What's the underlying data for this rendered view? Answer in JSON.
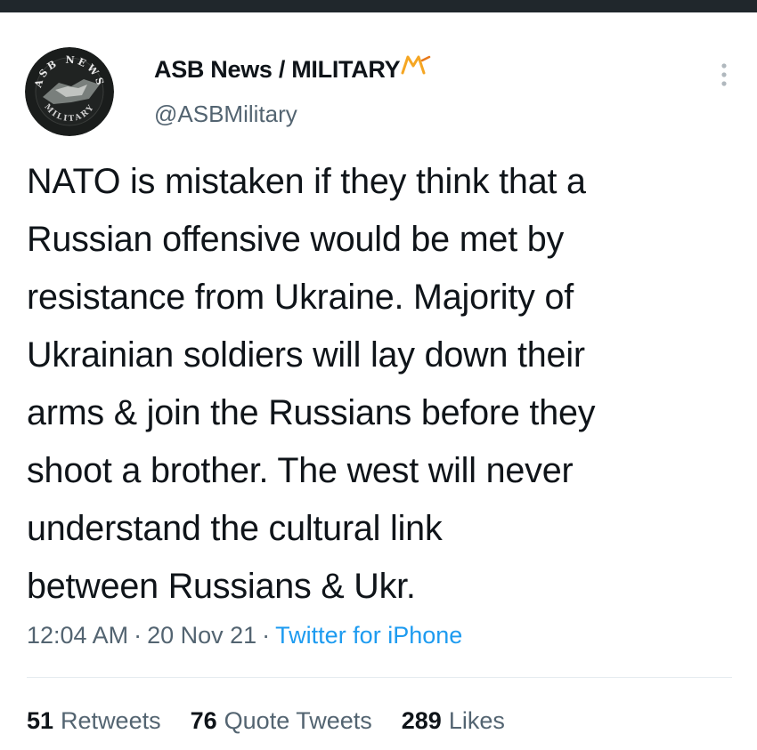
{
  "tweet": {
    "author": {
      "display_name": "ASB News / MILITARY",
      "handle": "@ASBMilitary",
      "avatar_text": "ASB NEWS",
      "avatar_text_bottom": "MILITARY"
    },
    "text": "NATO is mistaken if they think that a\nRussian offensive would be met by\nresistance from Ukraine. Majority of\nUkrainian soldiers will lay down their\narms & join the Russians before they\nshoot a brother. The west will never\nunderstand the cultural link\nbetween Russians & Ukr.",
    "time": "12:04 AM",
    "separator": "·",
    "date": "20 Nov 21",
    "source": "Twitter for iPhone",
    "stats": {
      "retweets": {
        "count": "51",
        "label": "Retweets"
      },
      "quote_tweets": {
        "count": "76",
        "label": "Quote Tweets"
      },
      "likes": {
        "count": "289",
        "label": "Likes"
      }
    }
  },
  "icons": {
    "more": "more-vertical-icon",
    "name_logo": "military-logo-icon"
  },
  "colors": {
    "top_bar": "#20272c",
    "text_primary": "#0f1419",
    "text_secondary": "#536471",
    "link": "#1d9bf0",
    "logo_accent": "#f5a623"
  }
}
